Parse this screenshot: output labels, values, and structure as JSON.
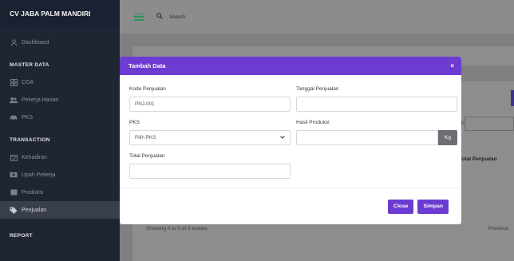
{
  "sidebar": {
    "brand": "CV JABA PALM MANDIRI",
    "dashboard": "Dashboard",
    "master_data_title": "MASTER DATA",
    "master_items": [
      "COA",
      "Pekerja Harian",
      "PKS"
    ],
    "transaction_title": "TRANSACTION",
    "transaction_items": [
      "Kehadiran",
      "Upah Pekerja",
      "Produksi",
      "Penjualan"
    ],
    "report_title": "REPORT",
    "active_item": "Penjualan"
  },
  "topbar": {
    "search_placeholder": "Search"
  },
  "background": {
    "search_label": "h:",
    "total_header": "Total Penjualan",
    "showing": "Showing 0 to 0 of 0 entries",
    "previous": "Previous"
  },
  "modal": {
    "title": "Tambah Data",
    "close_glyph": "×",
    "kode_label": "Kode Penjualan",
    "kode_value": "PNJ-001",
    "tanggal_label": "Tanggal Penjualan",
    "tanggal_value": "",
    "pks_label": "PKS",
    "pks_selected": "Pilih PKS",
    "hasil_label": "Hasil Produksi",
    "hasil_value": "",
    "hasil_unit": "Kg",
    "total_label": "Total Penjualan",
    "total_value": "",
    "close_button": "Close",
    "save_button": "Simpan"
  },
  "colors": {
    "accent": "#6c3bd2",
    "sidebar": "#1f2532",
    "backdrop": "#7f7f7f"
  }
}
